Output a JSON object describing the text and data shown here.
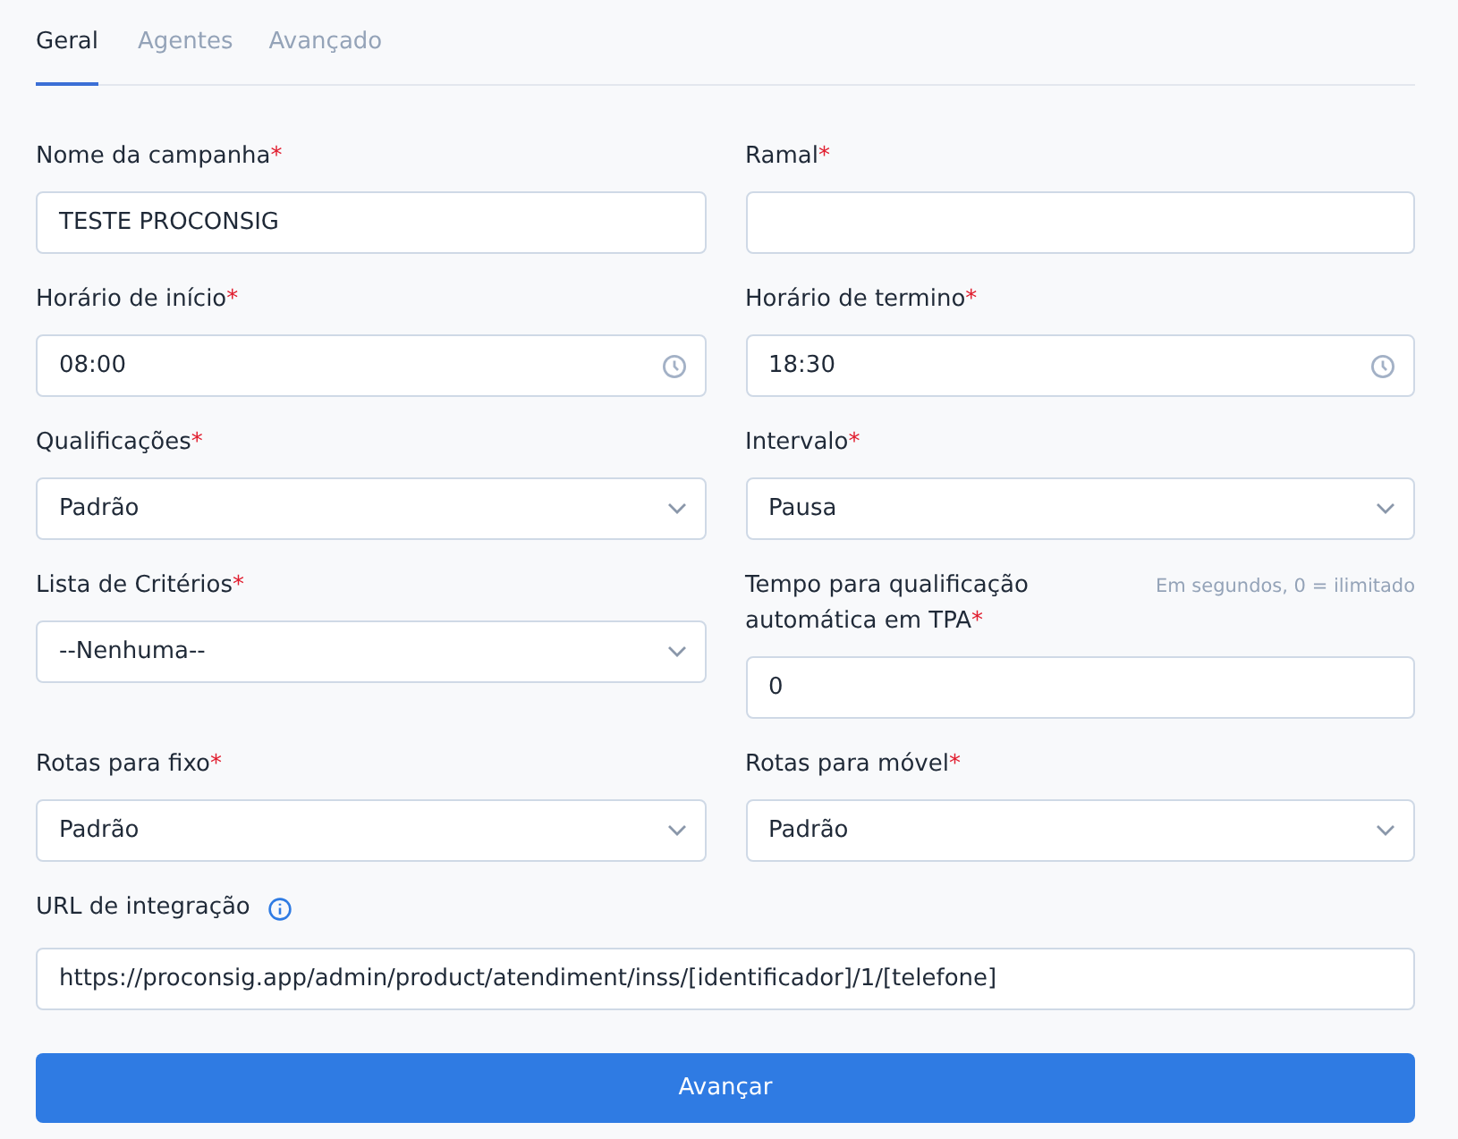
{
  "tabs": [
    {
      "label": "Geral",
      "selected": true
    },
    {
      "label": "Agentes",
      "selected": false
    },
    {
      "label": "Avançado",
      "selected": false
    }
  ],
  "rows": [
    [
      {
        "label": "Nome da campanha",
        "required_mark": "*",
        "kind": "text",
        "value": "TESTE PROCONSIG"
      },
      {
        "label": "Ramal",
        "required_mark": "*",
        "kind": "text"
      }
    ],
    [
      {
        "label": "Horário de início",
        "required_mark": "*",
        "kind": "time",
        "value": "08:00"
      },
      {
        "label": "Horário de termino",
        "required_mark": "*",
        "kind": "time",
        "value": "18:30"
      }
    ],
    [
      {
        "label": "Qualificações",
        "required_mark": "*",
        "kind": "select",
        "value": "Padrão"
      },
      {
        "label": "Intervalo",
        "required_mark": "*",
        "kind": "select",
        "value": "Pausa"
      }
    ],
    [
      {
        "label": "Lista de Critérios",
        "required_mark": "*",
        "kind": "select",
        "value": "--Nenhuma--"
      },
      {
        "label": "Tempo para qualificação automática em TPA",
        "required_mark": "*",
        "kind": "text",
        "value": "0",
        "hint": "Em segundos, 0 = ilimitado"
      }
    ],
    [
      {
        "label": "Rotas para fixo",
        "required_mark": "*",
        "kind": "select",
        "value": "Padrão"
      },
      {
        "label": "Rotas para móvel",
        "required_mark": "*",
        "kind": "select",
        "value": "Padrão"
      }
    ]
  ],
  "url_field": {
    "label": "URL de integração",
    "info": true,
    "value": "https://proconsig.app/admin/product/atendiment/inss/[identificador]/1/[telefone]"
  },
  "submit_button": "Avançar"
}
